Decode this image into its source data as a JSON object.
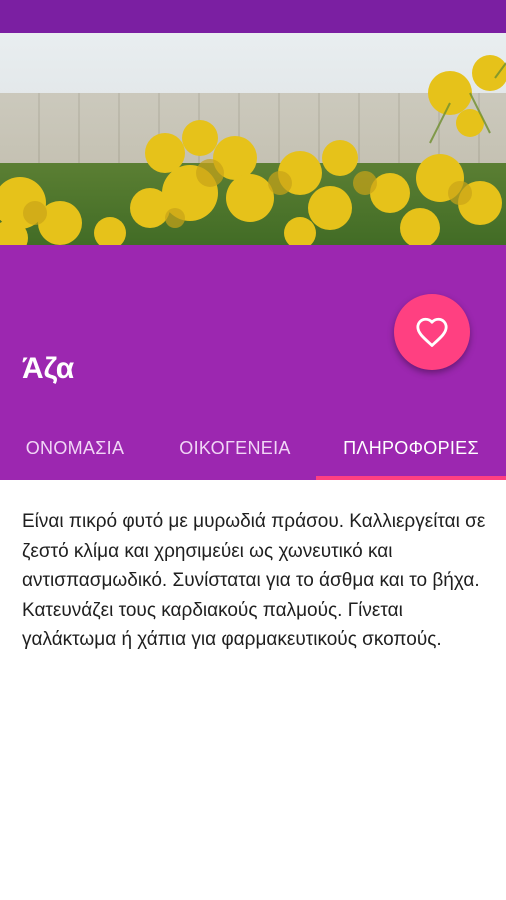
{
  "plant": {
    "title": "Άζα"
  },
  "tabs": [
    {
      "label": "ΟΝΟΜΑΣΙΑ"
    },
    {
      "label": "ΟΙΚΟΓΕΝΕΙΑ"
    },
    {
      "label": "ΠΛΗΡΟΦΟΡΙΕΣ"
    }
  ],
  "active_tab": "ΠΛΗΡΟΦΟΡΙΕΣ",
  "content": {
    "text": "Είναι πικρό φυτό με μυρωδιά πράσου. Καλλιεργείται σε ζεστό κλίμα και χρησιμεύει ως χωνευτικό και αντισπασμωδικό. Συνίσταται για το άσθμα και το βήχα. Κατευνάζει τους καρδιακούς παλμούς. Γίνεται γαλάκτωμα ή χάπια για φαρμακευτικούς σκοπούς."
  },
  "colors": {
    "status_bar": "#7b1fa2",
    "app_bar": "#9c27b0",
    "accent": "#ff4081"
  },
  "icons": {
    "favorite": "heart-outline-icon"
  }
}
